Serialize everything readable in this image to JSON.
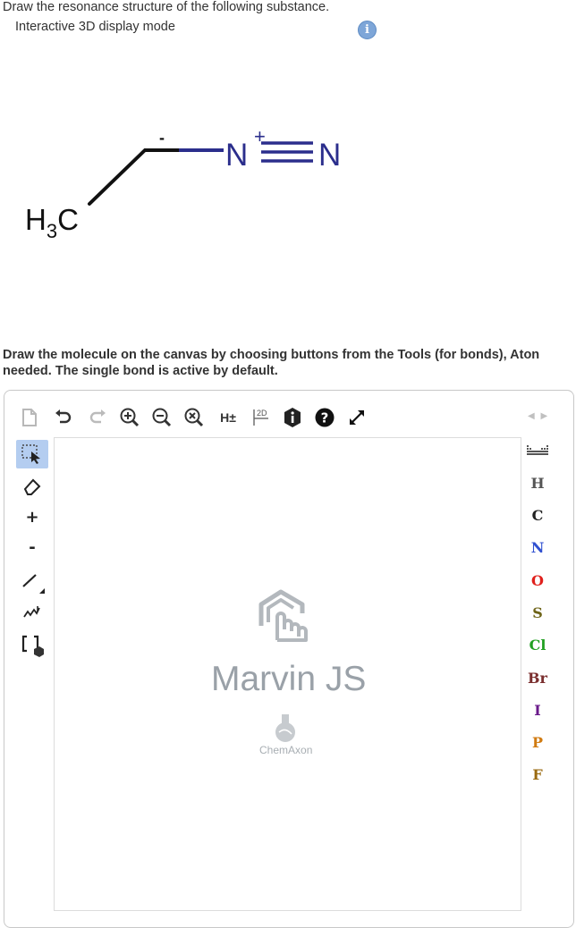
{
  "question": {
    "title": "Draw the resonance structure of the following substance.",
    "display_mode_label": "Interactive 3D display mode",
    "info_icon_glyph": "i"
  },
  "molecule": {
    "ch3_label": "H",
    "ch3_subscript": "3",
    "ch3_c": "C",
    "charge_minus": "-",
    "charge_plus": "+",
    "nitrogen_1": "N",
    "nitrogen_2": "N",
    "bond_color": "#2b2e8c",
    "skeleton_color": "#111111"
  },
  "instructions": {
    "line1": "Draw the molecule on the canvas by choosing buttons from the Tools (for bonds), Aton",
    "line2": "needed. The single bond is active by default."
  },
  "toolbar": {
    "items": [
      {
        "name": "new-document-icon"
      },
      {
        "name": "undo-icon"
      },
      {
        "name": "redo-icon"
      },
      {
        "name": "zoom-in-icon"
      },
      {
        "name": "zoom-out-icon"
      },
      {
        "name": "clear-icon"
      },
      {
        "name": "add-hydrogens-icon",
        "label": "H±"
      },
      {
        "name": "clean-2d-icon",
        "label": "2D"
      },
      {
        "name": "info-icon"
      },
      {
        "name": "help-icon"
      },
      {
        "name": "fullscreen-icon"
      }
    ]
  },
  "left_tools": {
    "charge_plus": "+",
    "charge_minus": "-",
    "items": [
      "select-tool",
      "eraser-tool",
      "increase-charge",
      "decrease-charge",
      "single-bond-tool",
      "chain-tool",
      "template-tool"
    ]
  },
  "elements": [
    {
      "symbol": "H",
      "color": "#555555"
    },
    {
      "symbol": "C",
      "color": "#222222"
    },
    {
      "symbol": "N",
      "color": "#3050d0"
    },
    {
      "symbol": "O",
      "color": "#e0201c"
    },
    {
      "symbol": "S",
      "color": "#6e6418"
    },
    {
      "symbol": "Cl",
      "color": "#22a022"
    },
    {
      "symbol": "Br",
      "color": "#7a2e2e"
    },
    {
      "symbol": "I",
      "color": "#6a1a8a"
    },
    {
      "symbol": "P",
      "color": "#d07a10"
    },
    {
      "symbol": "F",
      "color": "#9a6a10"
    }
  ],
  "canvas": {
    "logo_title": "Marvin JS",
    "logo_brand": "ChemAxon"
  }
}
